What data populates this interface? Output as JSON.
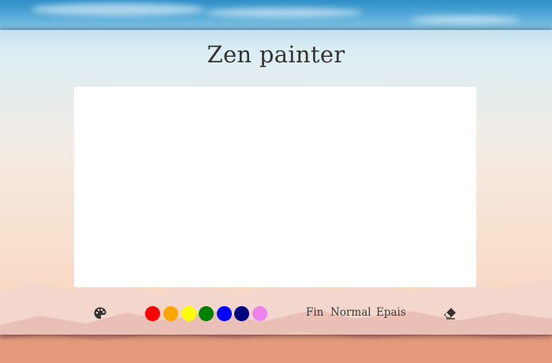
{
  "app": {
    "title": "Zen painter"
  },
  "toolbar": {
    "palette_icon": "palette-icon",
    "colors": [
      {
        "name": "red",
        "hex": "#ff0000"
      },
      {
        "name": "orange",
        "hex": "#ffa500"
      },
      {
        "name": "yellow",
        "hex": "#ffff00"
      },
      {
        "name": "green",
        "hex": "#008000"
      },
      {
        "name": "blue",
        "hex": "#0000ff"
      },
      {
        "name": "navy",
        "hex": "#000080"
      },
      {
        "name": "violet",
        "hex": "#ee82ee"
      }
    ],
    "sizes": [
      "Fin",
      "Normal",
      "Epais"
    ],
    "eraser_icon": "eraser-icon"
  },
  "theme": {
    "canvas_color": "#ffffff",
    "text_color": "#333333"
  }
}
